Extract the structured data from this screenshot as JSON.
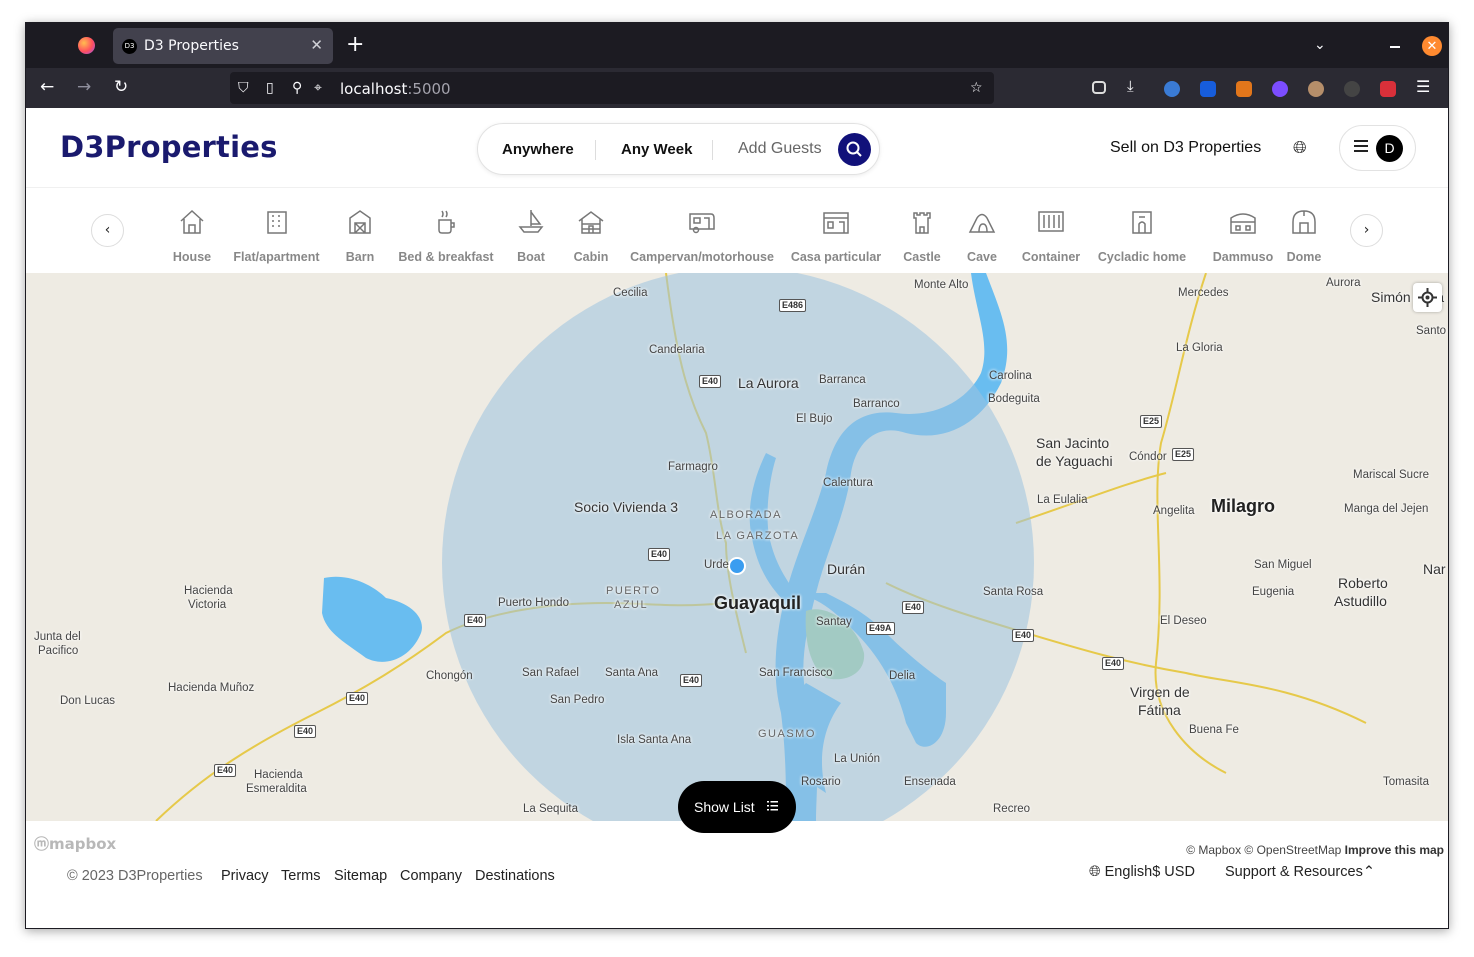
{
  "browser": {
    "tab_title": "D3 Properties",
    "tab_favicon_text": "D3",
    "url_host": "localhost",
    "url_port": ":5000"
  },
  "header": {
    "logo": "D3Properties",
    "search": {
      "where": "Anywhere",
      "when": "Any Week",
      "guests": "Add Guests"
    },
    "sell_label": "Sell on D3 Properties",
    "avatar_initial": "D"
  },
  "categories": [
    {
      "label": "House",
      "icon": "house-icon"
    },
    {
      "label": "Flat/apartment",
      "icon": "building-icon"
    },
    {
      "label": "Barn",
      "icon": "barn-icon"
    },
    {
      "label": "Bed & breakfast",
      "icon": "coffee-icon"
    },
    {
      "label": "Boat",
      "icon": "boat-icon"
    },
    {
      "label": "Cabin",
      "icon": "cabin-icon"
    },
    {
      "label": "Campervan/motorhouse",
      "icon": "camper-icon"
    },
    {
      "label": "Casa particular",
      "icon": "casa-icon"
    },
    {
      "label": "Castle",
      "icon": "castle-icon"
    },
    {
      "label": "Cave",
      "icon": "cave-icon"
    },
    {
      "label": "Container",
      "icon": "container-icon"
    },
    {
      "label": "Cycladic home",
      "icon": "cycladic-icon"
    },
    {
      "label": "Dammuso",
      "icon": "dammuso-icon"
    },
    {
      "label": "Dome",
      "icon": "dome-icon"
    }
  ],
  "map": {
    "places": {
      "cecilia": "Cecilia",
      "monte_alto": "Monte Alto",
      "mercedes": "Mercedes",
      "aurora": "Aurora",
      "simon": "Simón",
      "simon_tail": "Va",
      "santo": "Santo",
      "candelaria": "Candelaria",
      "la_gloria": "La Gloria",
      "la_aurora": "La Aurora",
      "barranca1": "Barranca",
      "barranca2": "Barranco",
      "carolina": "Carolina",
      "bodeguita": "Bodeguita",
      "el_bujo": "El Bujo",
      "san_jacinto": "San Jacinto",
      "de_yaguachi": "de Yaguachi",
      "condor": "Cóndor",
      "farmagro": "Farmagro",
      "calentura": "Calentura",
      "mariscal": "Mariscal Sucre",
      "la_eulalia": "La Eulalia",
      "angelita": "Angelita",
      "milagro": "Milagro",
      "manga": "Manga del Jejen",
      "socio": "Socio Vivienda 3",
      "alborada": "ALBORADA",
      "garzota": "LA GARZOTA",
      "urdesa": "Urde",
      "duran": "Durán",
      "san_miguel": "San Miguel",
      "nar": "Nar",
      "hacienda_victoria": "Hacienda",
      "victoria": "Victoria",
      "puerto_hondo": "Puerto Hondo",
      "puerto_azul1": "PUERTO",
      "puerto_azul2": "AZUL",
      "guayaquil": "Guayaquil",
      "santa_rosa": "Santa Rosa",
      "eugenia": "Eugenia",
      "roberto": "Roberto",
      "astudillo": "Astudillo",
      "junta": "Junta del",
      "pacifico": "Pacifico",
      "santay": "Santay",
      "el_deseo": "El Deseo",
      "chongon": "Chongón",
      "san_rafael": "San Rafael",
      "santa_ana": "Santa Ana",
      "san_francisco": "San Francisco",
      "delia": "Delia",
      "hacienda_munoz": "Hacienda Muñoz",
      "virgen": "Virgen de",
      "fatima": "Fátima",
      "don_lucas": "Don Lucas",
      "san_pedro": "San Pedro",
      "buena_fe": "Buena Fe",
      "isla_santa_ana": "Isla Santa Ana",
      "guasmo": "GUASMO",
      "la_union": "La Unión",
      "hacienda_esm1": "Hacienda",
      "hacienda_esm2": "Esmeraldita",
      "ensenada": "Ensenada",
      "tomasita": "Tomasita",
      "rosario": "Rosario",
      "la_sequita": "La Sequita",
      "recreo": "Recreo"
    },
    "shields": {
      "e486": "E486",
      "e40": "E40",
      "e25": "E25",
      "e49a": "E49A"
    },
    "show_list": "Show List"
  },
  "footer": {
    "mapbox": "mapbox",
    "attribution": "© Mapbox © OpenStreetMap",
    "improve": "Improve this map",
    "copyright": "© 2023 D3Properties",
    "links": [
      "Privacy",
      "Terms",
      "Sitemap",
      "Company",
      "Destinations"
    ],
    "language": "English",
    "currency": "$ USD",
    "support": "Support & Resources"
  },
  "colors": {
    "brand": "#11117a",
    "water": "#69bdf0",
    "radius": "#b7d3e8",
    "road": "#e6c94a"
  }
}
